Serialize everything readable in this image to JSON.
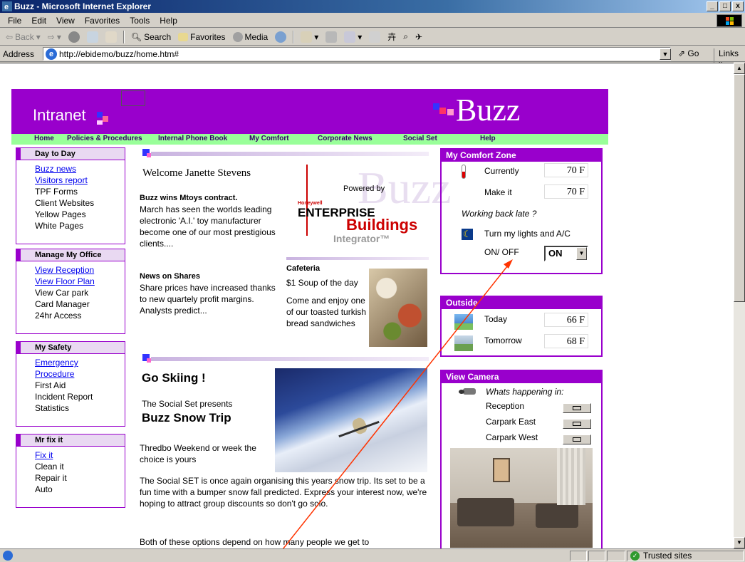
{
  "window": {
    "title": "Buzz - Microsoft Internet Explorer",
    "controls": [
      "_",
      "□",
      "x"
    ]
  },
  "menu": [
    "File",
    "Edit",
    "View",
    "Favorites",
    "Tools",
    "Help"
  ],
  "toolbar": {
    "back": "Back",
    "search": "Search",
    "favorites": "Favorites",
    "media": "Media"
  },
  "address": {
    "label": "Address",
    "url": "http://ebidemo/buzz/home.htm#",
    "go": "Go",
    "links": "Links"
  },
  "banner": {
    "intranet": "Intranet",
    "logo": "Buzz"
  },
  "nav": [
    "Home",
    "Policies & Procedures",
    "Internal Phone Book",
    "My Comfort",
    "Corporate News",
    "Social Set",
    "Help"
  ],
  "left": {
    "day": {
      "title": "Day to Day",
      "links": [
        "Buzz news",
        "Visitors report"
      ],
      "items": [
        "TPF Forms",
        "Client Websites",
        "Yellow Pages",
        "White Pages"
      ]
    },
    "office": {
      "title": "Manage My Office",
      "links": [
        "View Reception",
        "View Floor Plan"
      ],
      "items": [
        "View Car park",
        "Card Manager",
        "24hr Access"
      ]
    },
    "safety": {
      "title": "My Safety",
      "links": [
        "Emergency",
        "Procedure"
      ],
      "items": [
        "First Aid",
        "Incident Report",
        "Statistics"
      ]
    },
    "fixit": {
      "title": "Mr fix it",
      "links": [
        "Fix it"
      ],
      "items": [
        "Clean it",
        "Repair it",
        "Auto"
      ]
    }
  },
  "center": {
    "welcome": "Welcome Janette Stevens",
    "news1_title": "Buzz wins Mtoys contract.",
    "news1_body": "March has seen the worlds leading electronic 'A.I.' toy manufacturer become one of our most prestigious clients....",
    "news2_title": "News on Shares",
    "news2_body": "Share prices have increased thanks to new quartely profit margins. Analysts predict...",
    "powered_by": "Powered by",
    "honeywell": "Honeywell",
    "enterprise": "ENTERPRISE",
    "buildings": "Buildings",
    "integrator": "Integrator™",
    "cafeteria_title": "Cafeteria",
    "cafeteria_soup": "$1 Soup of the day",
    "cafeteria_body": "Come and enjoy one of our toasted turkish bread sandwiches",
    "ski_title": "Go Skiing !",
    "ski_presents": "The Social Set presents",
    "ski_trip": "Buzz Snow Trip",
    "ski_weekend": "Thredbo Weekend or week the choice is yours",
    "ski_body": "The Social SET is once again organising this years snow trip. Its set to be a fun time with a bumper snow fall predicted. Express your interest now, we're hoping to attract group discounts so don't go solo.",
    "ski_more": "Both of these options depend on how many people we get to"
  },
  "comfort": {
    "title": "My Comfort Zone",
    "currently_label": "Currently",
    "currently_value": "70 F",
    "makeit_label": "Make it",
    "makeit_value": "70 F",
    "late": "Working back late ?",
    "lights": "Turn my lights and A/C",
    "onoff_label": "ON/ OFF",
    "onoff_value": "ON"
  },
  "outside": {
    "title": "Outside",
    "today_label": "Today",
    "today_value": "66 F",
    "tomorrow_label": "Tomorrow",
    "tomorrow_value": "68 F"
  },
  "camera": {
    "title": "View Camera",
    "whats": "Whats happening in:",
    "locations": [
      "Reception",
      "Carpark East",
      "Carpark West"
    ]
  },
  "status": {
    "zone": "Trusted sites"
  },
  "colors": {
    "brand": "#9900cc",
    "nav": "#99ff99",
    "link": "#0000ee",
    "annotation": "#ff3300"
  }
}
